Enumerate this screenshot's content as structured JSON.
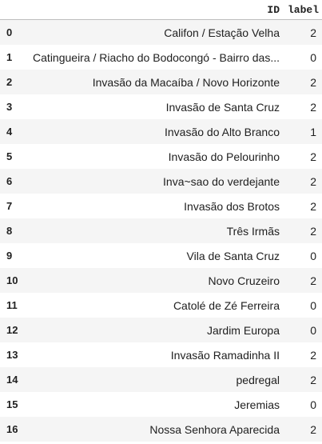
{
  "table": {
    "columns": {
      "id": "ID",
      "label": "label"
    },
    "rows": [
      {
        "index": "0",
        "id": "Califon / Estação Velha",
        "label": "2"
      },
      {
        "index": "1",
        "id": "Catingueira / Riacho do Bodocongó - Bairro das...",
        "label": "0"
      },
      {
        "index": "2",
        "id": "Invasão da Macaíba / Novo Horizonte",
        "label": "2"
      },
      {
        "index": "3",
        "id": "Invasão de Santa Cruz",
        "label": "2"
      },
      {
        "index": "4",
        "id": "Invasão do Alto Branco",
        "label": "1"
      },
      {
        "index": "5",
        "id": "Invasão do Pelourinho",
        "label": "2"
      },
      {
        "index": "6",
        "id": "Inva~sao do verdejante",
        "label": "2"
      },
      {
        "index": "7",
        "id": "Invasão dos Brotos",
        "label": "2"
      },
      {
        "index": "8",
        "id": "Três Irmãs",
        "label": "2"
      },
      {
        "index": "9",
        "id": "Vila de Santa Cruz",
        "label": "0"
      },
      {
        "index": "10",
        "id": "Novo Cruzeiro",
        "label": "2"
      },
      {
        "index": "11",
        "id": "Catolé de Zé Ferreira",
        "label": "0"
      },
      {
        "index": "12",
        "id": "Jardim Europa",
        "label": "0"
      },
      {
        "index": "13",
        "id": "Invasão Ramadinha II",
        "label": "2"
      },
      {
        "index": "14",
        "id": "pedregal",
        "label": "2"
      },
      {
        "index": "15",
        "id": "Jeremias",
        "label": "0"
      },
      {
        "index": "16",
        "id": "Nossa Senhora Aparecida",
        "label": "2"
      }
    ]
  }
}
